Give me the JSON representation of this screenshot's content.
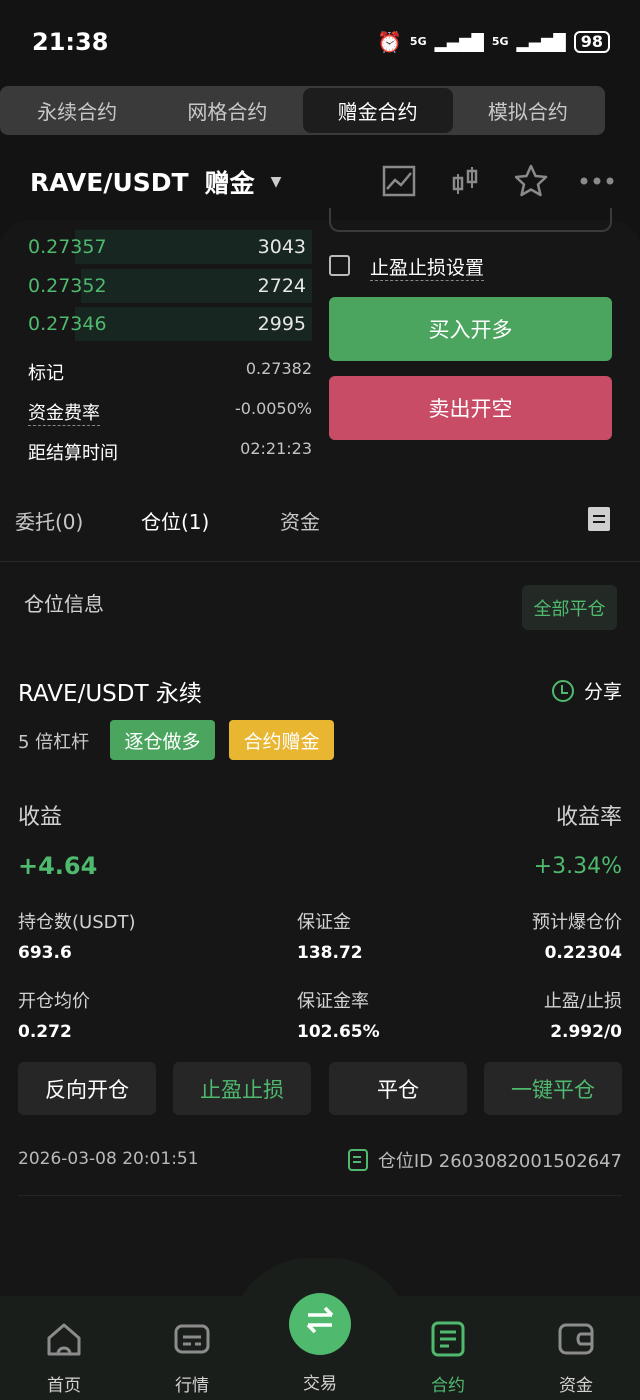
{
  "status_bar": {
    "time": "21:38",
    "battery": "98",
    "network": "5G"
  },
  "top_tabs": [
    "永续合约",
    "网格合约",
    "赠金合约",
    "模拟合约"
  ],
  "header": {
    "pair": "RAVE/USDT",
    "mode": "赠金"
  },
  "orderbook": [
    {
      "price": "0.27357",
      "qty": "3043",
      "depth": 0.76
    },
    {
      "price": "0.27352",
      "qty": "2724",
      "depth": 0.74
    },
    {
      "price": "0.27346",
      "qty": "2995",
      "depth": 0.76
    }
  ],
  "market_info": [
    {
      "label": "标记",
      "value": "0.27382"
    },
    {
      "label": "资金费率",
      "value": "-0.0050%"
    },
    {
      "label": "距结算时间",
      "value": "02:21:23"
    }
  ],
  "order_form": {
    "tp_sl_label": "止盈止损设置",
    "buy_label": "买入开多",
    "sell_label": "卖出开空"
  },
  "sub_tabs": [
    "委托(0)",
    "仓位(1)",
    "资金"
  ],
  "positions": {
    "title": "仓位信息",
    "close_all": "全部平仓",
    "pair": "RAVE/USDT 永续",
    "share": "分享",
    "leverage": "5 倍杠杆",
    "tag_side": "逐仓做多",
    "tag_bonus": "合约赠金",
    "pnl_label": "收益",
    "pnl_rate_label": "收益率",
    "pnl": "+4.64",
    "pnl_rate": "+3.34%",
    "stats": [
      {
        "label": "持仓数(USDT)",
        "value": "693.6"
      },
      {
        "label": "保证金",
        "value": "138.72"
      },
      {
        "label": "预计爆仓价",
        "value": "0.22304"
      },
      {
        "label": "开仓均价",
        "value": "0.272"
      },
      {
        "label": "保证金率",
        "value": "102.65%"
      },
      {
        "label": "止盈/止损",
        "value": "2.992/0"
      }
    ],
    "actions": [
      "反向开仓",
      "止盈止损",
      "平仓",
      "一键平仓"
    ],
    "timestamp": "2026-03-08 20:01:51",
    "position_id": "仓位ID 2603082001502647"
  },
  "bottom_nav": [
    "首页",
    "行情",
    "交易",
    "合约",
    "资金"
  ],
  "colors": {
    "green": "#4fb96e",
    "red": "#c94c67",
    "yellow": "#e8b631",
    "bg": "#131313"
  }
}
